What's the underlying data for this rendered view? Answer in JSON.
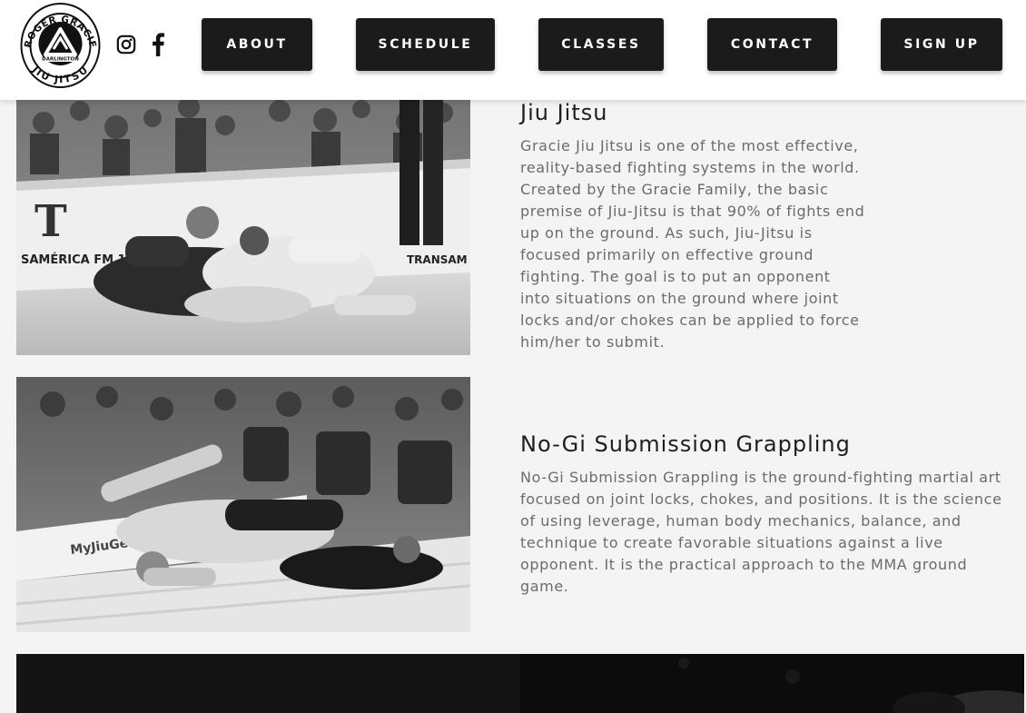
{
  "header": {
    "logo": {
      "top_text": "ROGER GRACIE",
      "sub_text": "DARLINGTON",
      "bottom_text": "JIU JITSU"
    },
    "social": [
      {
        "icon": "instagram-icon"
      },
      {
        "icon": "facebook-icon"
      }
    ],
    "nav": {
      "about": "ABOUT",
      "schedule": "SCHEDULE",
      "classes": "CLASSES",
      "contact": "CONTACT",
      "signup": "SIGN UP"
    }
  },
  "classes": [
    {
      "title": "Jiu Jitsu",
      "description": "Gracie Jiu Jitsu is one of the most effective, reality-based fighting systems in the world. Created by the Gracie Family, the basic premise of Jiu-Jitsu is that 90% of fights end up on the ground. As such, Jiu-Jitsu is focused primarily on effective ground fighting. The goal is to put an opponent into situations on the ground where joint locks and/or chokes can be applied to force him/her to submit.",
      "photo_text": {
        "banner": "SAMÉRICA FM 101",
        "banner_right": "TRANSAM"
      }
    },
    {
      "title": "No-Gi Submission Grappling",
      "description": "No-Gi Submission Grappling is the ground-fighting martial art focused on joint locks, chokes, and positions. It is the science of using leverage, human body mechanics, balance, and technique to create favorable situations against a live opponent. It is the practical approach to the MMA ground game.",
      "photo_text": {
        "banner": "MyJiuGear.com"
      }
    }
  ],
  "colors": {
    "nav_button_bg": "#1b1b1b",
    "nav_button_text": "#ffffff",
    "heading": "#1e1e1e",
    "body_text": "#6b6b6b",
    "page_bg": "#f4f4f4"
  }
}
